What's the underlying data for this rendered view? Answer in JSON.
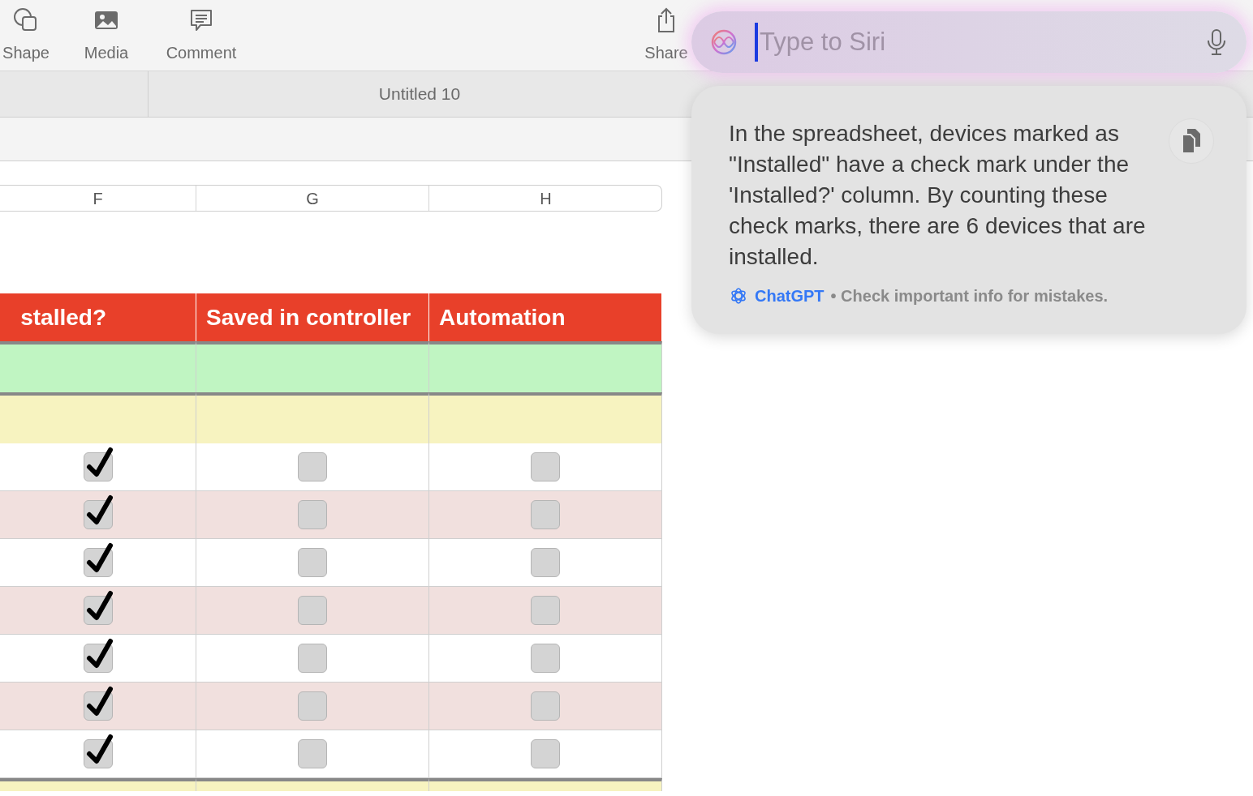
{
  "toolbar": {
    "items": [
      {
        "label": "Shape"
      },
      {
        "label": "Media"
      },
      {
        "label": "Comment"
      }
    ],
    "share": {
      "label": "Share"
    }
  },
  "sheet_tabs": [
    {
      "label": "Untitled 10",
      "selected": true
    }
  ],
  "table": {
    "column_letters": [
      "F",
      "G",
      "H"
    ],
    "columns": [
      "stalled?",
      "Saved in controller",
      "Automation"
    ],
    "rows": [
      {
        "kind": "group",
        "color": "#c0f5c2"
      },
      {
        "kind": "group",
        "color": "#f7f3c0"
      },
      {
        "kind": "device",
        "checks": [
          true,
          false,
          false
        ]
      },
      {
        "kind": "device",
        "checks": [
          true,
          false,
          false
        ]
      },
      {
        "kind": "device",
        "checks": [
          true,
          false,
          false
        ]
      },
      {
        "kind": "device",
        "checks": [
          true,
          false,
          false
        ]
      },
      {
        "kind": "device",
        "checks": [
          true,
          false,
          false
        ]
      },
      {
        "kind": "device",
        "checks": [
          true,
          false,
          false
        ]
      },
      {
        "kind": "device",
        "checks": [
          true,
          false,
          false
        ]
      },
      {
        "kind": "group",
        "color": "#f7f3c0"
      }
    ]
  },
  "siri": {
    "placeholder": "Type to Siri",
    "response": "In the spreadsheet, devices marked as \"Installed\" have a check mark under the 'Installed?' column. By counting these check marks, there are 6 devices that are installed.",
    "source": "ChatGPT",
    "disclaimer": "• Check important info for mistakes."
  }
}
